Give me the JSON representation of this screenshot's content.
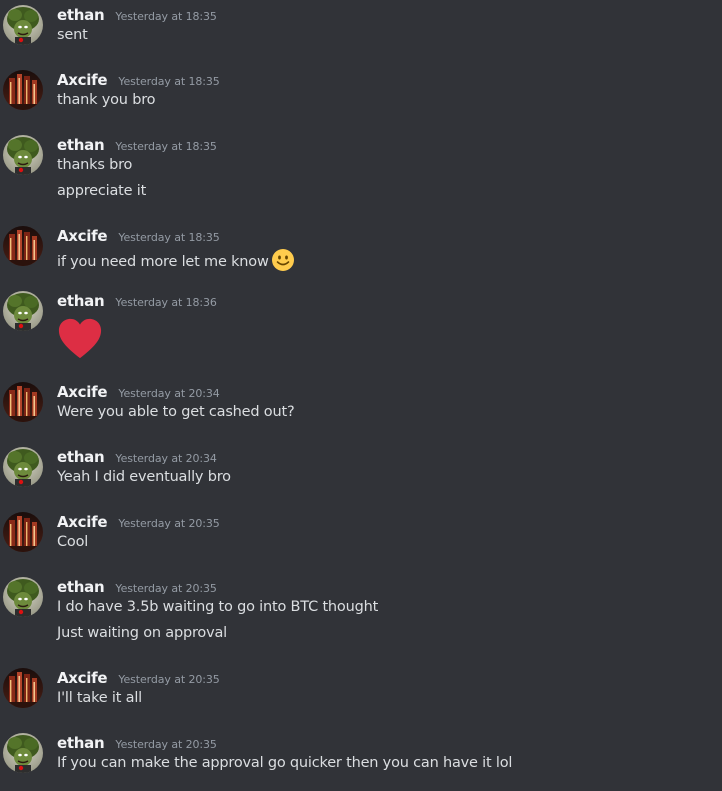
{
  "users": {
    "ethan": "ethan",
    "axcife": "Axcife"
  },
  "messages": [
    {
      "author": "ethan",
      "timestamp": "Yesterday at 18:35",
      "lines": [
        "sent"
      ]
    },
    {
      "author": "Axcife",
      "timestamp": "Yesterday at 18:35",
      "lines": [
        "thank you bro"
      ]
    },
    {
      "author": "ethan",
      "timestamp": "Yesterday at 18:35",
      "lines": [
        "thanks bro",
        "appreciate it"
      ]
    },
    {
      "author": "Axcife",
      "timestamp": "Yesterday at 18:35",
      "lines": [
        "if you need more let me know"
      ],
      "inline_emoji": "slightly-smiling-face-icon"
    },
    {
      "author": "ethan",
      "timestamp": "Yesterday at 18:36",
      "lines": [],
      "big_emoji": "red-heart-icon"
    },
    {
      "author": "Axcife",
      "timestamp": "Yesterday at 20:34",
      "lines": [
        "Were you able to get cashed out?"
      ]
    },
    {
      "author": "ethan",
      "timestamp": "Yesterday at 20:34",
      "lines": [
        "Yeah I did eventually bro"
      ]
    },
    {
      "author": "Axcife",
      "timestamp": "Yesterday at 20:35",
      "lines": [
        "Cool"
      ]
    },
    {
      "author": "ethan",
      "timestamp": "Yesterday at 20:35",
      "lines": [
        "I do have 3.5b waiting to go into BTC thought",
        "Just waiting on approval"
      ]
    },
    {
      "author": "Axcife",
      "timestamp": "Yesterday at 20:35",
      "lines": [
        "I'll take it all"
      ]
    },
    {
      "author": "ethan",
      "timestamp": "Yesterday at 20:35",
      "lines": [
        "If you can make the approval go quicker then you can have it lol"
      ]
    }
  ],
  "colors": {
    "background": "#313338",
    "username": "#f2f3f5",
    "timestamp": "#949ba4",
    "text": "#dbdee1",
    "heart": "#dd2e44",
    "smiley": "#ffcc4d"
  }
}
